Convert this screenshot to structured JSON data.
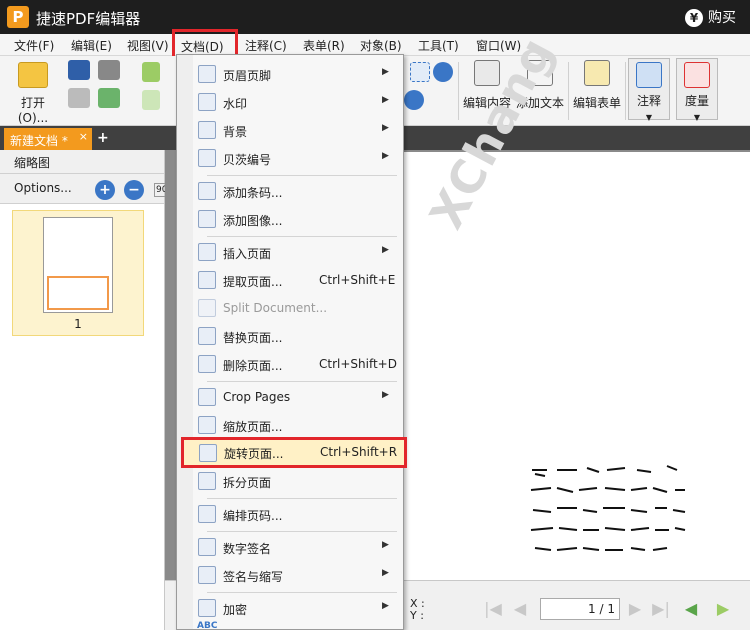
{
  "app": {
    "logo_letter": "P",
    "title": "捷速PDF编辑器",
    "buy_label": "购买",
    "yen": "¥"
  },
  "menubar": {
    "items": [
      {
        "label": "文件(F)"
      },
      {
        "label": "编辑(E)"
      },
      {
        "label": "视图(V)"
      },
      {
        "label": "文档(D)"
      },
      {
        "label": "注释(C)"
      },
      {
        "label": "表单(R)"
      },
      {
        "label": "对象(B)"
      },
      {
        "label": "工具(T)"
      },
      {
        "label": "窗口(W)"
      }
    ]
  },
  "toolbar": {
    "open_label": "打开(O)...",
    "edit_content": "编辑内容",
    "add_text": "添加文本",
    "edit_form": "编辑表单",
    "annotate": "注释",
    "measure": "度量"
  },
  "tabs": {
    "doc_tab": "新建文档 *",
    "close": "×",
    "add": "+"
  },
  "left_panel": {
    "title": "缩略图",
    "options": "Options...",
    "rotate_90": "90°",
    "page_number": "1"
  },
  "document": {
    "watermark": "XChang"
  },
  "status": {
    "x_label": "X :",
    "y_label": "Y :",
    "page_display": "1 / 1"
  },
  "dropdown": {
    "items": [
      {
        "label": "页眉页脚",
        "shortcut": "",
        "submenu": true,
        "icon": "header-footer-icon"
      },
      {
        "label": "水印",
        "shortcut": "",
        "submenu": true,
        "icon": "watermark-icon"
      },
      {
        "label": "背景",
        "shortcut": "",
        "submenu": true,
        "icon": "background-icon"
      },
      {
        "label": "贝茨编号",
        "shortcut": "",
        "submenu": true,
        "icon": "bates-number-icon"
      },
      {
        "label": "添加条码...",
        "shortcut": "",
        "submenu": false,
        "icon": "barcode-icon"
      },
      {
        "label": "添加图像...",
        "shortcut": "",
        "submenu": false,
        "icon": "image-icon"
      },
      {
        "label": "插入页面",
        "shortcut": "",
        "submenu": true,
        "icon": "insert-page-icon"
      },
      {
        "label": "提取页面...",
        "shortcut": "Ctrl+Shift+E",
        "submenu": false,
        "icon": "extract-page-icon"
      },
      {
        "label": "Split Document...",
        "shortcut": "",
        "submenu": false,
        "icon": "split-document-icon",
        "disabled": true
      },
      {
        "label": "替换页面...",
        "shortcut": "",
        "submenu": false,
        "icon": "replace-page-icon"
      },
      {
        "label": "删除页面...",
        "shortcut": "Ctrl+Shift+D",
        "submenu": false,
        "icon": "delete-page-icon"
      },
      {
        "label": "Crop Pages",
        "shortcut": "",
        "submenu": true,
        "icon": "crop-pages-icon"
      },
      {
        "label": "缩放页面...",
        "shortcut": "",
        "submenu": false,
        "icon": "scale-page-icon"
      },
      {
        "label": "旋转页面...",
        "shortcut": "Ctrl+Shift+R",
        "submenu": false,
        "icon": "rotate-page-icon",
        "highlighted": true
      },
      {
        "label": "拆分页面",
        "shortcut": "",
        "submenu": false,
        "icon": "split-page-icon"
      },
      {
        "label": "编排页码...",
        "shortcut": "",
        "submenu": false,
        "icon": "page-numbering-icon"
      },
      {
        "label": "数字签名",
        "shortcut": "",
        "submenu": true,
        "icon": "digital-signature-icon"
      },
      {
        "label": "签名与缩写",
        "shortcut": "",
        "submenu": true,
        "icon": "sign-initials-icon"
      },
      {
        "label": "加密",
        "shortcut": "",
        "submenu": true,
        "icon": "encrypt-icon"
      }
    ],
    "partial_label": "ABC"
  },
  "colors": {
    "accent": "#f39a1e",
    "highlight_border": "#e2262b",
    "titlebar": "#1e1e1e"
  }
}
